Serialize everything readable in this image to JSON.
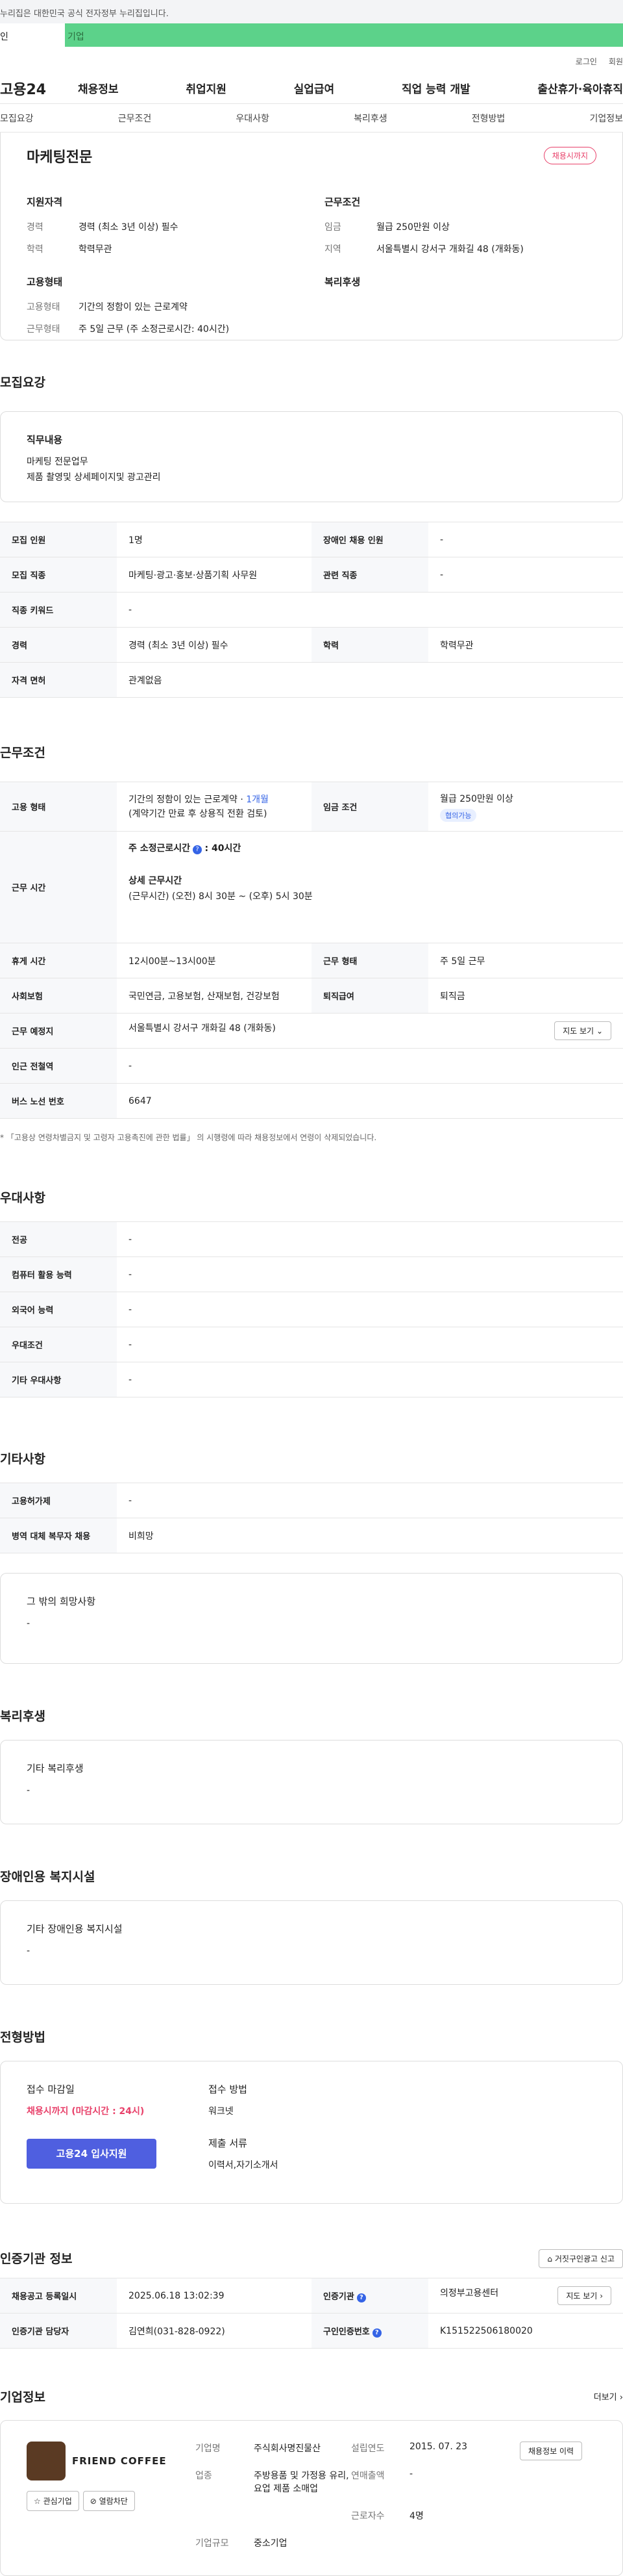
{
  "gov_bar": "누리집은 대한민국 공식 전자정부 누리집입니다.",
  "top_tabs": [
    "인",
    "기업"
  ],
  "util": [
    "로그인",
    "회원"
  ],
  "gnb": {
    "logo": "고용24",
    "menu": [
      "채용정보",
      "취업지원",
      "실업급여",
      "직업 능력 개발",
      "출산휴가·육아휴직"
    ]
  },
  "subnav": [
    "모집요강",
    "근무조건",
    "우대사항",
    "복리후생",
    "전형방법",
    "기업정보"
  ],
  "summary": {
    "title": "마케팅전문",
    "badge": "채용시까지",
    "qual_title": "지원자격",
    "qual": [
      {
        "k": "경력",
        "v": "경력 (최소 3년 이상) 필수"
      },
      {
        "k": "학력",
        "v": "학력무관"
      }
    ],
    "work_title": "근무조건",
    "work": [
      {
        "k": "임금",
        "v": "월급 250만원 이상"
      },
      {
        "k": "지역",
        "v": "서울특별시 강서구 개화길 48 (개화동)"
      }
    ],
    "emp_title": "고용형태",
    "emp": [
      {
        "k": "고용형태",
        "v": "기간의 정함이 있는 근로계약"
      },
      {
        "k": "근무형태",
        "v": "주 5일 근무 (주 소정근로시간: 40시간)"
      }
    ],
    "welfare_title": "복리후생"
  },
  "recruit": {
    "title": "모집요강",
    "duty_title": "직무내용",
    "duty_lines": [
      "마케팅 전문업무",
      "제품 촬영및 상세페이지및 광고관리"
    ],
    "rows": [
      [
        "모집 인원",
        "1명",
        "장애인 채용 인원",
        "-"
      ],
      [
        "모집 직종",
        "마케팅·광고·홍보·상품기획 사무원",
        "관련 직종",
        "-"
      ],
      [
        "직종 키워드",
        "-",
        "",
        ""
      ],
      [
        "경력",
        "경력 (최소 3년 이상) 필수",
        "학력",
        "학력무관"
      ],
      [
        "자격 면허",
        "관계없음",
        "",
        ""
      ]
    ]
  },
  "work": {
    "title": "근무조건",
    "emp_type_k": "고용 형태",
    "emp_type_v1": "기간의 정함이 있는 근로계약 · ",
    "emp_type_months": "1개월",
    "emp_type_v2": "(계약기간 만료 후 상용직 전환 검토)",
    "wage_k": "임금 조건",
    "wage_v": "월급 250만원 이상",
    "wage_pill": "협의가능",
    "hours_k": "근무 시간",
    "hours_week": "주 소정근로시간",
    "hours_week_v": ": 40시간",
    "hours_detail_title": "상세 근무시간",
    "hours_detail": "(근무시간) (오전) 8시 30분 ~ (오후) 5시 30분",
    "rows": [
      [
        "휴게 시간",
        "12시00분~13시00분",
        "근무 형태",
        "주 5일 근무"
      ],
      [
        "사회보험",
        "국민연금, 고용보험, 산재보험, 건강보험",
        "퇴직급여",
        "퇴직금"
      ]
    ],
    "place_k": "근무 예정지",
    "place_v": "서울특별시 강서구 개화길 48 (개화동)",
    "map_btn": "지도 보기",
    "subway_k": "인근 전철역",
    "subway_v": "-",
    "bus_k": "버스 노선 번호",
    "bus_v": "6647",
    "note": "* 「고용상 연령차별금지 및 고령자 고용촉진에 관한 법률」 의 시행령에 따라 채용정보에서 연령이 삭제되었습니다."
  },
  "pref": {
    "title": "우대사항",
    "rows": [
      [
        "전공",
        "-"
      ],
      [
        "컴퓨터 활용 능력",
        "-"
      ],
      [
        "외국어 능력",
        "-"
      ],
      [
        "우대조건",
        "-"
      ],
      [
        "기타 우대사항",
        "-"
      ]
    ]
  },
  "etc": {
    "title": "기타사항",
    "rows": [
      [
        "고용허가제",
        "-"
      ],
      [
        "병역 대체 복무자 채용",
        "비희망"
      ]
    ],
    "other_title": "그 밖의 희망사항",
    "other_v": "-"
  },
  "welfare": {
    "title": "복리후생",
    "sub": "기타 복리후생",
    "v": "-"
  },
  "disab": {
    "title": "장애인용 복지시설",
    "sub": "기타 장애인용 복지시설",
    "v": "-"
  },
  "process": {
    "title": "전형방법",
    "deadline_k": "접수 마감일",
    "deadline_v": "채용시까지 (마감시간 : 24시)",
    "apply_btn": "고용24 입사지원",
    "method_k": "접수 방법",
    "method_v": "워크넷",
    "docs_k": "제출 서류",
    "docs_v": "이력서,자기소개서"
  },
  "agency": {
    "title": "인증기관 정보",
    "report_btn": "거짓구인광고 신고",
    "rows": [
      [
        "채용공고 등록일시",
        "2025.06.18 13:02:39",
        "인증기관",
        "의정부고용센터"
      ],
      [
        "인증기관 담당자",
        "김연희(031-828-0922)",
        "구인인증번호",
        "K151522506180020"
      ]
    ],
    "map_btn": "지도 보기"
  },
  "company": {
    "title": "기업정보",
    "more": "더보기",
    "brand": "FRIEND COFFEE",
    "chips": [
      "관심기업",
      "열람차단"
    ],
    "fields": [
      [
        "기업명",
        "주식회사명진물산",
        "설립연도",
        "2015. 07. 23"
      ],
      [
        "업종",
        "주방용품 및 가정용 유리, 요업 제품 소매업",
        "연매출액",
        "-"
      ],
      [
        "",
        "",
        "근로자수",
        "4명"
      ],
      [
        "기업규모",
        "중소기업",
        "",
        ""
      ]
    ],
    "history_btn": "채용정보 이력"
  }
}
